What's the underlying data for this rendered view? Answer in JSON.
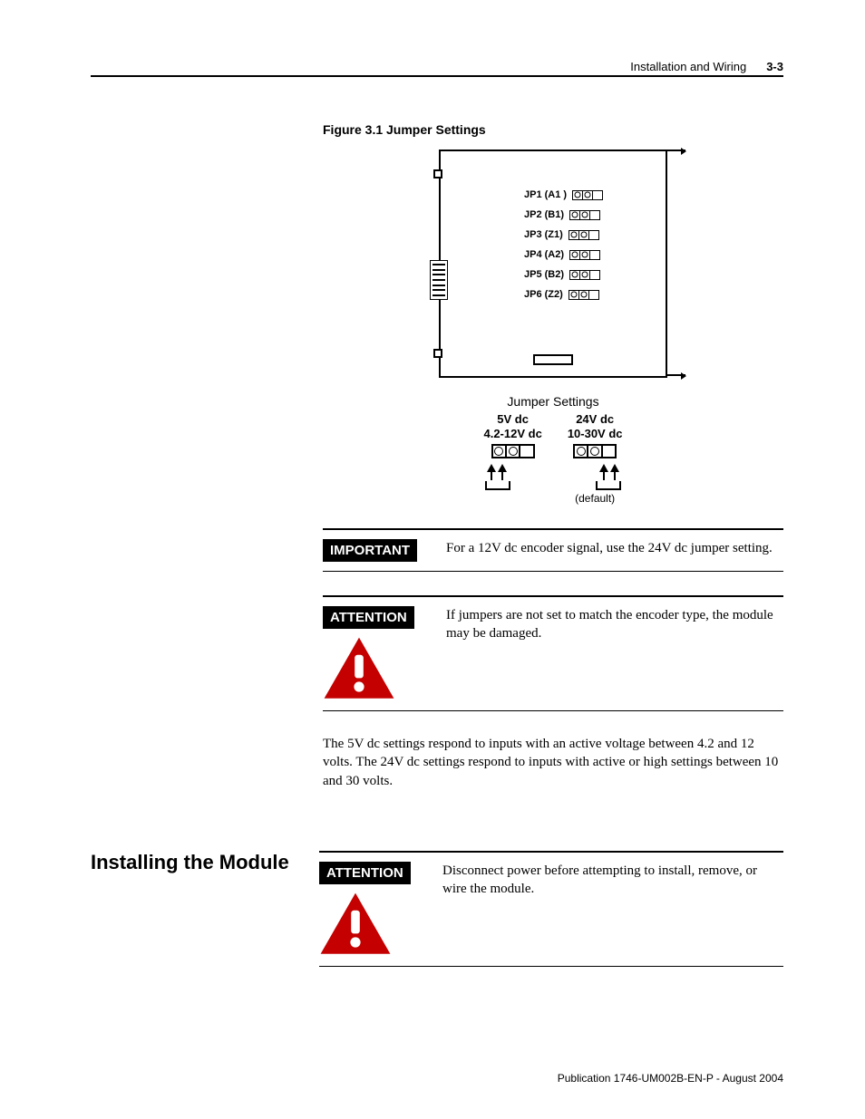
{
  "header": {
    "section_title": "Installation and Wiring",
    "page_number": "3-3"
  },
  "figure": {
    "caption": "Figure 3.1 Jumper Settings",
    "jumpers": [
      "JP1 (A1 )",
      "JP2 (B1)",
      "JP3 (Z1)",
      "JP4 (A2)",
      "JP5 (B2)",
      "JP6 (Z2)"
    ]
  },
  "jumper_settings": {
    "heading": "Jumper Settings",
    "columns": [
      {
        "line1": "5V dc",
        "line2": "4.2-12V dc"
      },
      {
        "line1": "24V dc",
        "line2": "10-30V dc"
      }
    ],
    "default_label": "(default)"
  },
  "callouts": {
    "important": {
      "label": "IMPORTANT",
      "text": "For a 12V dc encoder signal, use the 24V dc jumper setting."
    },
    "attention1": {
      "label": "ATTENTION",
      "text": "If jumpers are not set to match the encoder type, the module may be damaged."
    }
  },
  "body_paragraph": "The 5V dc settings respond to inputs with an active voltage between 4.2 and 12 volts. The 24V dc settings respond to inputs with active or high settings between 10 and 30 volts.",
  "installing": {
    "heading": "Installing the Module",
    "attention": {
      "label": "ATTENTION",
      "text": "Disconnect power before attempting to install, remove, or wire the module."
    }
  },
  "footer": {
    "publication": "Publication 1746-UM002B-EN-P - August 2004"
  }
}
